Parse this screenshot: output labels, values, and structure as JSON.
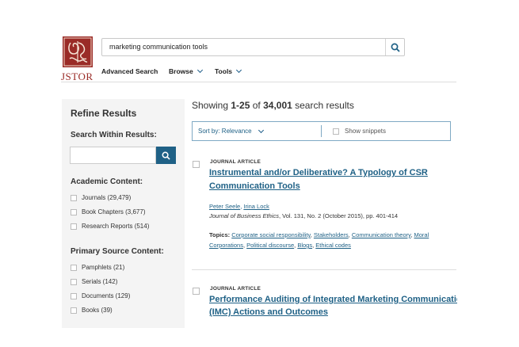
{
  "header": {
    "logo_text": "JSTOR",
    "search_value": "marketing communication tools",
    "nav": [
      "Advanced Search",
      "Browse",
      "Tools"
    ]
  },
  "sidebar": {
    "title": "Refine Results",
    "search_within_label": "Search Within Results:",
    "academic_title": "Academic Content:",
    "academic_items": [
      "Journals (29,479)",
      "Book Chapters (3,677)",
      "Research Reports (514)"
    ],
    "primary_title": "Primary Source Content:",
    "primary_items": [
      "Pamphlets (21)",
      "Serials (142)",
      "Documents (129)",
      "Books (39)"
    ]
  },
  "results": {
    "showing_prefix": "Showing ",
    "range": "1-25",
    "of": " of ",
    "total": "34,001",
    "suffix": " search results",
    "sort_label": "Sort by: Relevance",
    "snippets_label": "Show snippets",
    "items": [
      {
        "type": "JOURNAL ARTICLE",
        "title_line1": "Instrumental and/or Deliberative? A Typology of CSR",
        "title_line2": "Communication Tools",
        "author1": "Peter Seele",
        "author_sep": ", ",
        "author2": "Irina Lock",
        "journal": "Journal of Business Ethics",
        "citation_rest": ", Vol. 131, No. 2 (October 2015), pp. 401-414",
        "topics_label": "Topics:",
        "topics": [
          "Corporate social responsibility",
          "Stakeholders",
          "Communication theory",
          "Moral",
          "Corporations",
          "Political discourse",
          "Blogs",
          "Ethical codes"
        ]
      },
      {
        "type": "JOURNAL ARTICLE",
        "title_line1": "Performance Auditing of Integrated Marketing Communicatio",
        "title_line2": "(IMC) Actions and Outcomes"
      }
    ]
  },
  "colors": {
    "brand": "#9a2b27",
    "accent": "#1f6186"
  }
}
